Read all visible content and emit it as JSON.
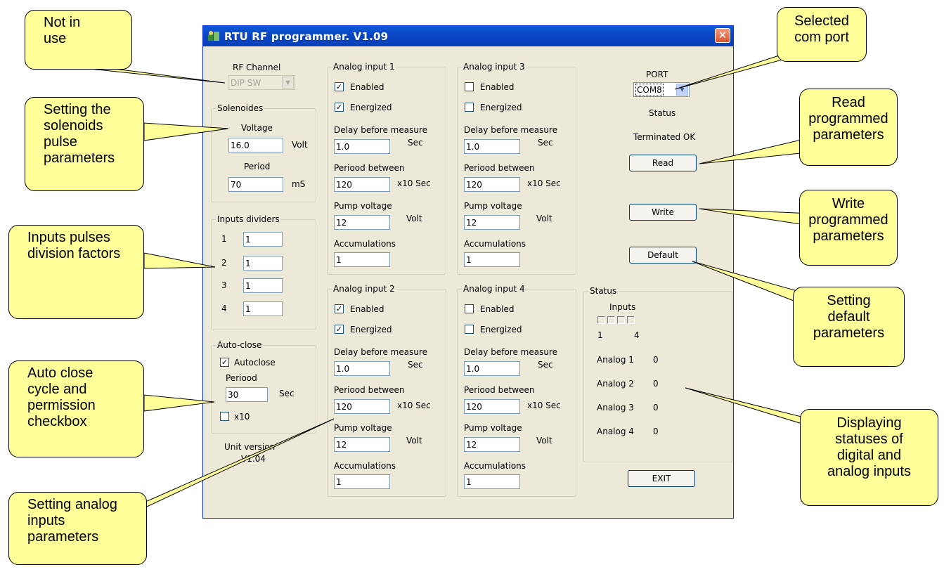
{
  "window": {
    "title": "RTU RF programmer. V1.09"
  },
  "rf_channel": {
    "label": "RF Channel",
    "value": "DIP SW"
  },
  "solenoides": {
    "title": "Solenoides",
    "voltage_label": "Voltage",
    "voltage_value": "16.0",
    "voltage_unit": "Volt",
    "period_label": "Period",
    "period_value": "70",
    "period_unit": "mS"
  },
  "inputs_dividers": {
    "title": "Inputs dividers",
    "rows": [
      {
        "num": "1",
        "value": "1"
      },
      {
        "num": "2",
        "value": "1"
      },
      {
        "num": "3",
        "value": "1"
      },
      {
        "num": "4",
        "value": "1"
      }
    ]
  },
  "auto_close": {
    "title": "Auto-close",
    "autoclose_label": "Autoclose",
    "autoclose_checked": true,
    "period_label": "Periood",
    "period_value": "30",
    "period_unit": "Sec",
    "x10_label": "x10",
    "x10_checked": false
  },
  "unit_version": {
    "label": "Unit version",
    "value": "V1.04"
  },
  "analog_inputs": [
    {
      "title": "Analog input 1",
      "enabled_label": "Enabled",
      "enabled": true,
      "energized_label": "Energized",
      "energized": true,
      "delay_label": "Delay before measure",
      "delay_value": "1.0",
      "delay_unit": "Sec",
      "period_label": "Periood between",
      "period_value": "120",
      "period_unit": "x10 Sec",
      "pump_label": "Pump voltage",
      "pump_value": "12",
      "pump_unit": "Volt",
      "accum_label": "Accumulations",
      "accum_value": "1"
    },
    {
      "title": "Analog input 3",
      "enabled_label": "Enabled",
      "enabled": false,
      "energized_label": "Energized",
      "energized": false,
      "delay_label": "Delay before measure",
      "delay_value": "1.0",
      "delay_unit": "Sec",
      "period_label": "Periood between",
      "period_value": "120",
      "period_unit": "x10 Sec",
      "pump_label": "Pump voltage",
      "pump_value": "12",
      "pump_unit": "Volt",
      "accum_label": "Accumulations",
      "accum_value": "1"
    },
    {
      "title": "Analog input 2",
      "enabled_label": "Enabled",
      "enabled": true,
      "energized_label": "Energized",
      "energized": true,
      "delay_label": "Delay before measure",
      "delay_value": "1.0",
      "delay_unit": "Sec",
      "period_label": "Periood between",
      "period_value": "120",
      "period_unit": "x10 Sec",
      "pump_label": "Pump voltage",
      "pump_value": "12",
      "pump_unit": "Volt",
      "accum_label": "Accumulations",
      "accum_value": "1"
    },
    {
      "title": "Analog input 4",
      "enabled_label": "Enabled",
      "enabled": false,
      "energized_label": "Energized",
      "energized": false,
      "delay_label": "Delay before measure",
      "delay_value": "1.0",
      "delay_unit": "Sec",
      "period_label": "Periood between",
      "period_value": "120",
      "period_unit": "x10 Sec",
      "pump_label": "Pump voltage",
      "pump_value": "12",
      "pump_unit": "Volt",
      "accum_label": "Accumulations",
      "accum_value": "1"
    }
  ],
  "port": {
    "label": "PORT",
    "value": "COM8",
    "status_label": "Status",
    "status_value": "Terminated OK"
  },
  "buttons": {
    "read": "Read",
    "write": "Write",
    "default": "Default",
    "exit": "EXIT"
  },
  "status": {
    "title": "Status",
    "inputs_label": "Inputs",
    "inputs_first": "1",
    "inputs_last": "4",
    "analogs": [
      {
        "label": "Analog 1",
        "value": "0"
      },
      {
        "label": "Analog 2",
        "value": "0"
      },
      {
        "label": "Analog 3",
        "value": "0"
      },
      {
        "label": "Analog 4",
        "value": "0"
      }
    ]
  },
  "callouts": {
    "not_in_use": "Not in use",
    "solenoids": "Setting the solenoids pulse parameters",
    "inputs_pulses": "Inputs pulses division factors",
    "auto_close": "Auto close cycle and permission checkbox",
    "analog": "Setting analog inputs parameters",
    "com_port": "Selected com port",
    "read": "Read programmed parameters",
    "write": "Write programmed parameters",
    "default": "Setting default parameters",
    "statuses": "Displaying statuses of digital and analog inputs"
  },
  "colors": {
    "callout_fill": "#ffff99",
    "titlebar": "#0b46c6",
    "dialog_bg": "#ece9d8",
    "close_button": "#d9542c"
  }
}
